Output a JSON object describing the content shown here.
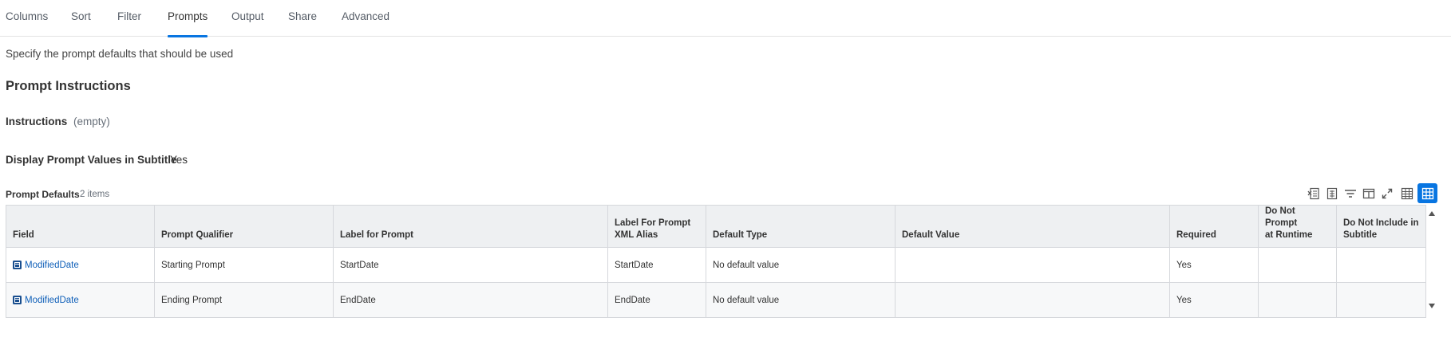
{
  "tabs": [
    {
      "label": "Columns"
    },
    {
      "label": "Sort"
    },
    {
      "label": "Filter"
    },
    {
      "label": "Prompts",
      "active": true
    },
    {
      "label": "Output"
    },
    {
      "label": "Share"
    },
    {
      "label": "Advanced"
    }
  ],
  "description": "Specify the prompt defaults that should be used",
  "section_title": "Prompt Instructions",
  "instructions": {
    "label": "Instructions",
    "value": "(empty)"
  },
  "display_prompt": {
    "label": "Display Prompt Values in Subtitle",
    "value": "Yes"
  },
  "grid": {
    "title": "Prompt Defaults",
    "count": "2 items",
    "toolbar_icons": [
      "export-to-excel-icon",
      "export-to-pdf-icon",
      "filter-icon",
      "column-layout-icon",
      "fullscreen-icon",
      "table-view-icon",
      "grid-view-icon"
    ],
    "columns": [
      {
        "line1": "Field",
        "line2": ""
      },
      {
        "line1": "Prompt Qualifier",
        "line2": ""
      },
      {
        "line1": "Label for Prompt",
        "line2": ""
      },
      {
        "line1": "Label For Prompt",
        "line2": "XML Alias"
      },
      {
        "line1": "Default Type",
        "line2": ""
      },
      {
        "line1": "Default Value",
        "line2": ""
      },
      {
        "line1": "Required",
        "line2": ""
      },
      {
        "line1": "Do Not Prompt",
        "line2": "at Runtime"
      },
      {
        "line1": "Do Not Include in",
        "line2": "Subtitle"
      }
    ],
    "rows": [
      {
        "field": "ModifiedDate",
        "qualifier": "Starting Prompt",
        "label": "StartDate",
        "xml_alias": "StartDate",
        "default_type": "No default value",
        "default_value": "",
        "required": "Yes",
        "do_not_prompt": "",
        "do_not_include": ""
      },
      {
        "field": "ModifiedDate",
        "qualifier": "Ending Prompt",
        "label": "EndDate",
        "xml_alias": "EndDate",
        "default_type": "No default value",
        "default_value": "",
        "required": "Yes",
        "do_not_prompt": "",
        "do_not_include": ""
      }
    ]
  },
  "colors": {
    "accent": "#0875e1",
    "link": "#0f5fb8"
  }
}
